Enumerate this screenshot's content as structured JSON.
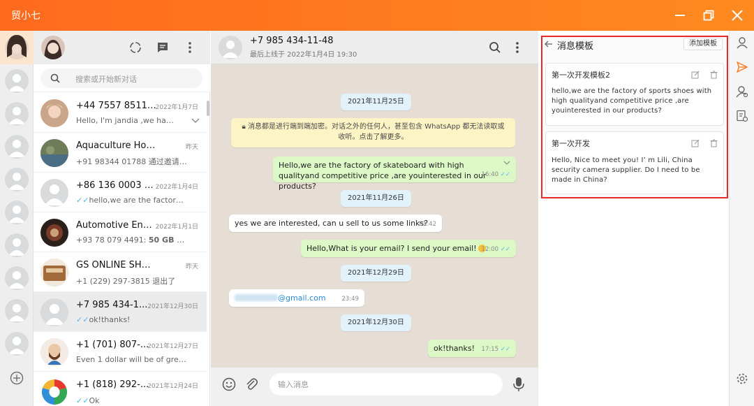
{
  "app": {
    "title": "贸小七"
  },
  "list_search": {
    "placeholder": "搜索或开始新对话"
  },
  "chats": [
    {
      "name": "+44 7557 851104",
      "date": "2022年1月7日",
      "preview": "Hello, I'm jandia ,we have a g...",
      "avatar_color": "#c9a68a"
    },
    {
      "name": "Aquaculture Hotspot ...",
      "date": "昨天",
      "preview": "+91 98344 01788 通过邀请链接...",
      "avatar_color": "#6e7c59"
    },
    {
      "name": "+86 136 0003 8...",
      "date": "2022年1月4日",
      "preview": "hello,we are the factory of sp...",
      "avatar_color": "#d9dadb"
    },
    {
      "name": "Automotive Engi...",
      "date": "2022年1月1日",
      "preview_prefix": "+93 78 079 4491: ",
      "preview_bold": "50 GB Free int...",
      "avatar_color": "#7a3a2a"
    },
    {
      "name": "GS ONLINE SHOPPING",
      "date": "昨天",
      "preview": "+1 (229) 297-3815 退出了",
      "avatar_color": "#a06a3a"
    },
    {
      "name": "+7 985 434-1...",
      "date": "2021年12月30日",
      "preview": "ok!thanks!",
      "avatar_color": "#d9dadb"
    },
    {
      "name": "+1 (701) 807-...",
      "date": "2021年12月27日",
      "preview": "Even 1 dollar  will be of great help",
      "avatar_color": "#e9d8c8"
    },
    {
      "name": "+1 (818) 292-...",
      "date": "2021年12月24日",
      "preview": "Ok",
      "avatar_color": "#3aa0d8"
    }
  ],
  "conversation": {
    "phone": "+7 985 434-11-48",
    "last_seen": "最后上线于 2022年1月4日 19:30",
    "encryption_notice": "消息都是进行端到端加密。对话之外的任何人，甚至包含 WhatsApp 都无法读取或收听。点击了解更多。",
    "dates": [
      "2021年11月25日",
      "2021年11月26日",
      "2021年12月29日",
      "2021年12月30日"
    ],
    "messages": [
      {
        "text": "Hello,we are the factory of skateboard with high qualityand competitive price ,are youinterested in our products?",
        "time": "16:40",
        "dir": "out"
      },
      {
        "text": "yes we are interested, can u sell to us some links?",
        "time": "01:42",
        "dir": "in"
      },
      {
        "text": "Hello,What is your email? I send your email!",
        "time": "12:00",
        "dir": "out"
      },
      {
        "text": "@gmail.com",
        "time": "23:49",
        "dir": "in"
      },
      {
        "text": "ok!thanks!",
        "time": "17:15",
        "dir": "out"
      }
    ],
    "composer_placeholder": "输入消息"
  },
  "templates": {
    "title": "消息模板",
    "add_label": "添加模板",
    "items": [
      {
        "title": "第一次开发模板2",
        "body_lines": [
          "hello,we are the factory of sports shoes with",
          "high qualityand competitive price ,are",
          "youinterested in our products?"
        ]
      },
      {
        "title": "第一次开发",
        "body_lines": [
          "Hello, Nice to meet you!  I’ m Lili, China",
          "security camera supplier. Do I need to be",
          "made in China?"
        ]
      }
    ]
  },
  "colors": {
    "accent": "#ff7a1f",
    "outgoing": "#dcf8c6",
    "highlight": "#e8282b"
  }
}
